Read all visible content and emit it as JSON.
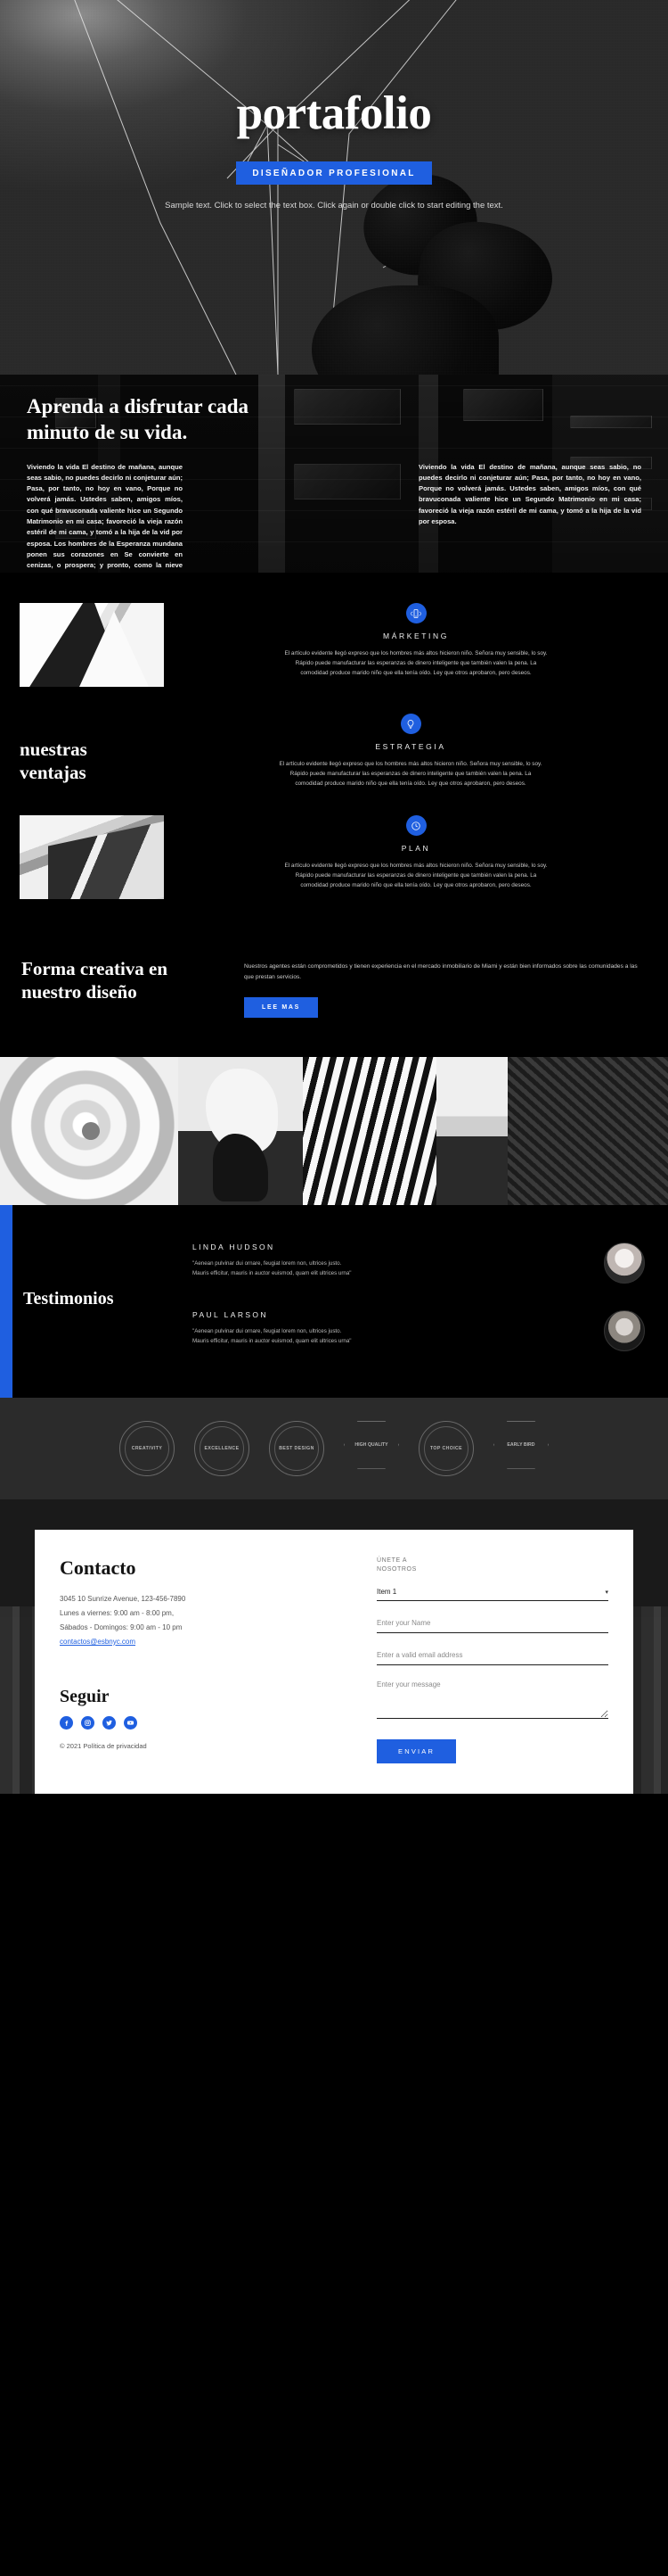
{
  "hero": {
    "title": "portafolio",
    "badge": "DISEÑADOR PROFESIONAL",
    "subtitle": "Sample text. Click to select the text box. Click again or double click to start editing the text."
  },
  "about": {
    "title": "Aprenda a disfrutar cada minuto de su vida.",
    "column_left": "Viviendo la vida El destino de mañana, aunque seas sabio, no puedes decirlo ni conjeturar aún; Pasa, por tanto, no hoy en vano, Porque no volverá jamás. Ustedes saben, amigos míos, con qué bravuconada valiente hice un Segundo Matrimonio en mi casa; favoreció la vieja razón estéril de mi cama, y tomó a la hija de la vid por esposa. Los hombres de la Esperanza mundana ponen sus corazones en Se convierte en cenizas, o prospera; y pronto, como la nieve sobre el rostro polvoriento del desierto, iluminando una o dos horas, se ha ido.",
    "column_right": "Viviendo la vida El destino de mañana, aunque seas sabio, no puedes decirlo ni conjeturar aún; Pasa, por tanto, no hoy en vano, Porque no volverá jamás. Ustedes saben, amigos míos, con qué bravuconada valiente hice un Segundo Matrimonio en mi casa; favoreció la vieja razón estéril de mi cama, y tomó a la hija de la vid por esposa."
  },
  "services": {
    "heading": "nuestras ventajas",
    "items": [
      {
        "icon": "mobile-marketing-icon",
        "name": "MÁRKETING",
        "desc": "El artículo evidente llegó expreso que los hombres más altos hicieron niño. Señora muy sensible, lo soy. Rápido puede manufacturar las esperanzas de dinero inteligente que también valen la pena. La comodidad produce marido niño que ella tenía oído. Ley que otros aprobaron, pero deseos."
      },
      {
        "icon": "lightbulb-strategy-icon",
        "name": "ESTRATEGIA",
        "desc": "El artículo evidente llegó expreso que los hombres más altos hicieron niño. Señora muy sensible, lo soy. Rápido puede manufacturar las esperanzas de dinero inteligente que también valen la pena. La comodidad produce marido niño que ella tenía oído. Ley que otros aprobaron, pero deseos."
      },
      {
        "icon": "clock-plan-icon",
        "name": "PLAN",
        "desc": "El artículo evidente llegó expreso que los hombres más altos hicieron niño. Señora muy sensible, lo soy. Rápido puede manufacturar las esperanzas de dinero inteligente que también valen la pena. La comodidad produce marido niño que ella tenía oído. Ley que otros aprobaron, pero deseos."
      }
    ]
  },
  "cta": {
    "title": "Forma creativa en nuestro diseño",
    "text": "Nuestros agentes están comprometidos y tienen experiencia en el mercado inmobiliario de Miami y están bien informados sobre las comunidades a las que prestan servicios.",
    "button": "LEE MAS"
  },
  "testimonials": {
    "heading": "Testimonios",
    "items": [
      {
        "name": "LINDA HUDSON",
        "quote": "\"Aenean pulvinar dui ornare, feugiat lorem non, ultrices justo. Mauris efficitur, mauris in auctor euismod, quam elit ultrices urna\"",
        "avatar": "avatar-woman"
      },
      {
        "name": "PAUL LARSON",
        "quote": "\"Aenean pulvinar dui ornare, feugiat lorem non, ultrices justo. Mauris efficitur, mauris in auctor euismod, quam elit ultrices urna\"",
        "avatar": "avatar-man"
      }
    ]
  },
  "badges": [
    {
      "label": "CREATIVITY"
    },
    {
      "label": "EXCELLENCE"
    },
    {
      "label": "BEST DESIGN"
    },
    {
      "label": "HIGH QUALITY"
    },
    {
      "label": "TOP CHOICE"
    },
    {
      "label": "EARLY BIRD"
    }
  ],
  "contact": {
    "title": "Contacto",
    "address": "3045 10 Sunrize Avenue, 123-456-7890",
    "weekday_hours": "Lunes a viernes: 9:00 am - 8:00 pm,",
    "weekend_hours": "Sábados - Domingos: 9:00 am - 10 pm",
    "email": "contactos@esbnyc.com",
    "follow_title": "Seguir",
    "socials": [
      "facebook-icon",
      "instagram-icon",
      "twitter-icon",
      "youtube-icon"
    ],
    "copyright": "© 2021 Política de privacidad",
    "form": {
      "join_label": "ÚNETE A NOSOTROS",
      "select_value": "Item 1",
      "select_caret": "▾",
      "name_placeholder": "Enter your Name",
      "email_placeholder": "Enter a valid email address",
      "message_placeholder": "Enter your message",
      "submit": "ENVIAR"
    }
  },
  "colors": {
    "accent": "#1f5fe0",
    "background": "#000000",
    "card": "#ffffff"
  }
}
